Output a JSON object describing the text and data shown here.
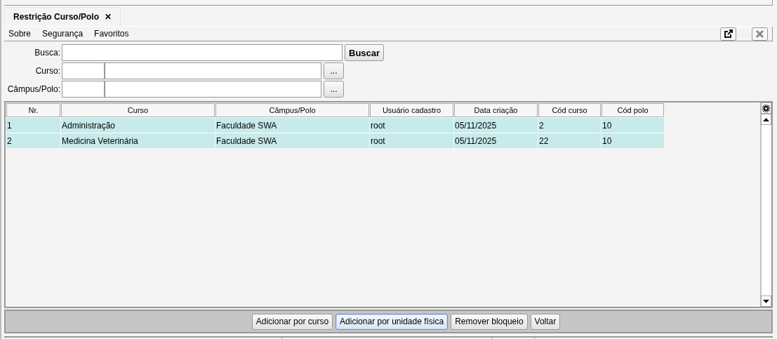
{
  "tabs": [
    {
      "label": "Restrição Curso/Polo",
      "close": "✕",
      "selected": true
    }
  ],
  "menu": [
    "Sobre",
    "Segurança",
    "Favoritos"
  ],
  "form": {
    "search": {
      "label": "Busca:",
      "button": "Buscar"
    },
    "lookups": [
      {
        "label": "Curso:",
        "button": "..."
      },
      {
        "label": "Câmpus/Polo:",
        "button": "..."
      }
    ]
  },
  "table": {
    "columns": [
      "Nr.",
      "Curso",
      "Câmpus/Polo",
      "Usuário cadastro",
      "Data criação",
      "Cód curso",
      "Cód polo"
    ],
    "rows": [
      [
        "1",
        "Administração",
        "Faculdade SWA",
        "root",
        "05/11/2025",
        "2",
        "10"
      ],
      [
        "2",
        "Medicina Veterinária",
        "Faculdade SWA",
        "root",
        "05/11/2025",
        "22",
        "10"
      ]
    ]
  },
  "buttons": [
    {
      "label": "Adicionar por curso",
      "focused": false
    },
    {
      "label": "Adicionar por unidade física",
      "focused": true
    },
    {
      "label": "Remover bloqueio",
      "focused": false
    },
    {
      "label": "Voltar",
      "focused": false
    }
  ]
}
